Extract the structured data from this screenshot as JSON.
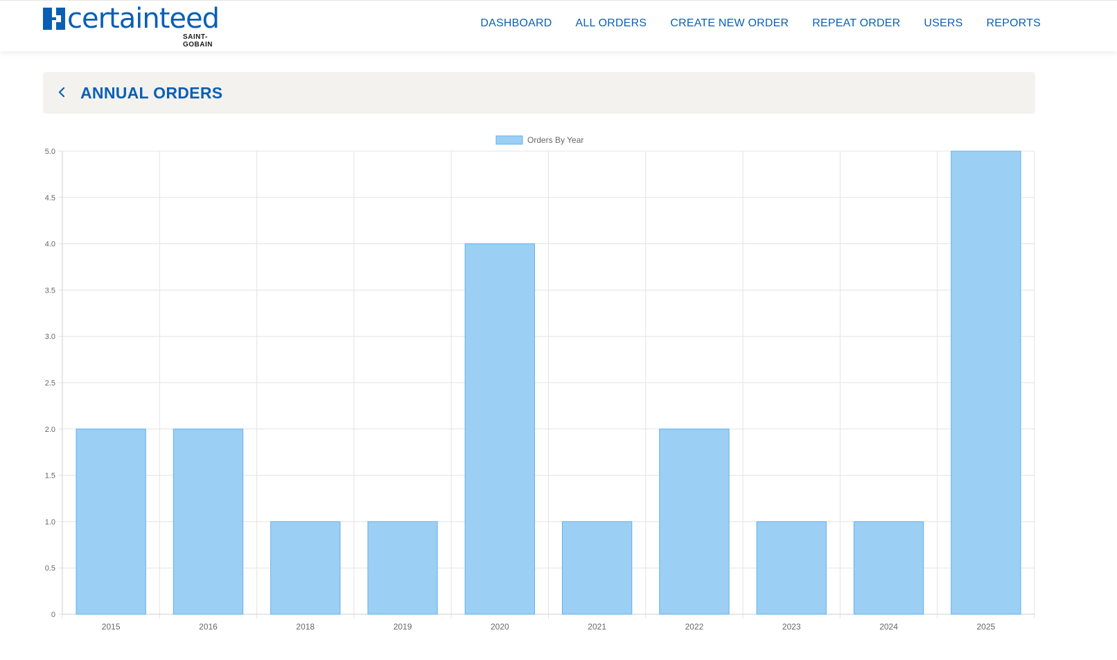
{
  "brand": {
    "wordmark": "certainteed",
    "subline": "SAINT-GOBAIN",
    "color": "#0a5fb4"
  },
  "nav": {
    "items": [
      {
        "label": "DASHBOARD"
      },
      {
        "label": "ALL ORDERS"
      },
      {
        "label": "CREATE NEW ORDER"
      },
      {
        "label": "REPEAT ORDER"
      },
      {
        "label": "USERS"
      },
      {
        "label": "REPORTS"
      }
    ]
  },
  "page": {
    "back_icon": "chevron-left-icon",
    "title": "ANNUAL ORDERS"
  },
  "chart_data": {
    "type": "bar",
    "categories": [
      "2015",
      "2016",
      "2018",
      "2019",
      "2020",
      "2021",
      "2022",
      "2023",
      "2024",
      "2025"
    ],
    "series": [
      {
        "name": "Orders By Year",
        "values": [
          2,
          2,
          1,
          1,
          4,
          1,
          2,
          1,
          1,
          5
        ]
      }
    ],
    "ylim": [
      0,
      5
    ],
    "yticks": [
      "0",
      "0.5",
      "1.0",
      "1.5",
      "2.0",
      "2.5",
      "3.0",
      "3.5",
      "4.0",
      "4.5",
      "5.0"
    ],
    "grid": true,
    "legend": "top-center",
    "bar_fill": "#9ccff4",
    "bar_stroke": "#5fb2eb"
  }
}
